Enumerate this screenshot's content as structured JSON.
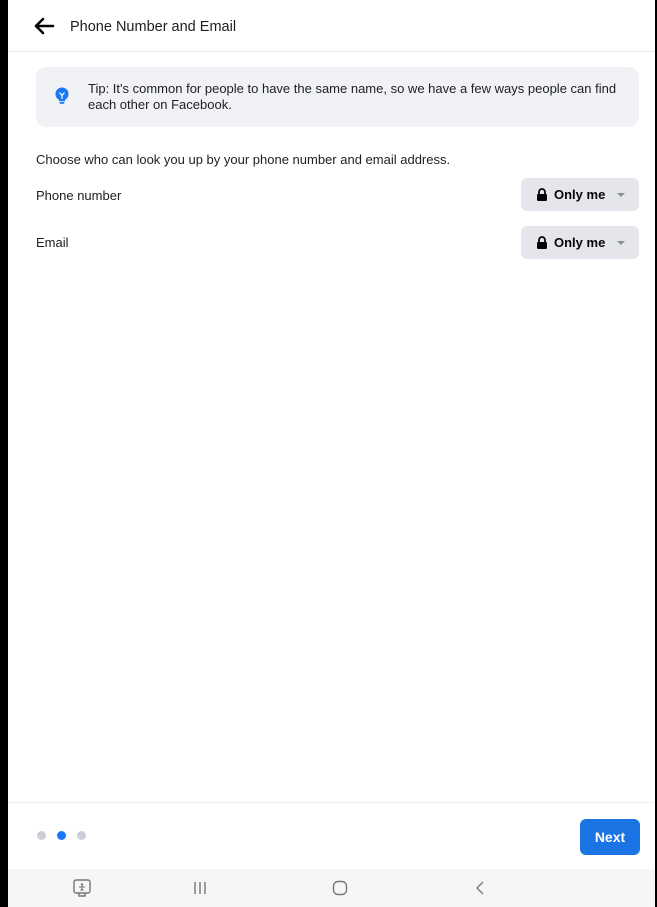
{
  "header": {
    "title": "Phone Number and Email"
  },
  "tip": {
    "text": "Tip: It's common for people to have the same name, so we have a few ways people can find each other on Facebook."
  },
  "intro": "Choose who can look you up by your phone number and email address.",
  "settings": [
    {
      "label": "Phone number",
      "audience": "Only me"
    },
    {
      "label": "Email",
      "audience": "Only me"
    }
  ],
  "progress": {
    "total_steps": 3,
    "current_step": 2
  },
  "footer": {
    "next_label": "Next"
  },
  "colors": {
    "accent": "#1877f2",
    "next_button": "#1b74e4",
    "tip_background": "#f0f2f5",
    "audience_button": "#e4e6eb"
  },
  "icons": [
    "back-arrow-icon",
    "lightbulb-icon",
    "lock-icon",
    "dropdown-caret-icon",
    "recent-apps-icon",
    "home-icon",
    "android-back-icon",
    "accessibility-icon"
  ]
}
